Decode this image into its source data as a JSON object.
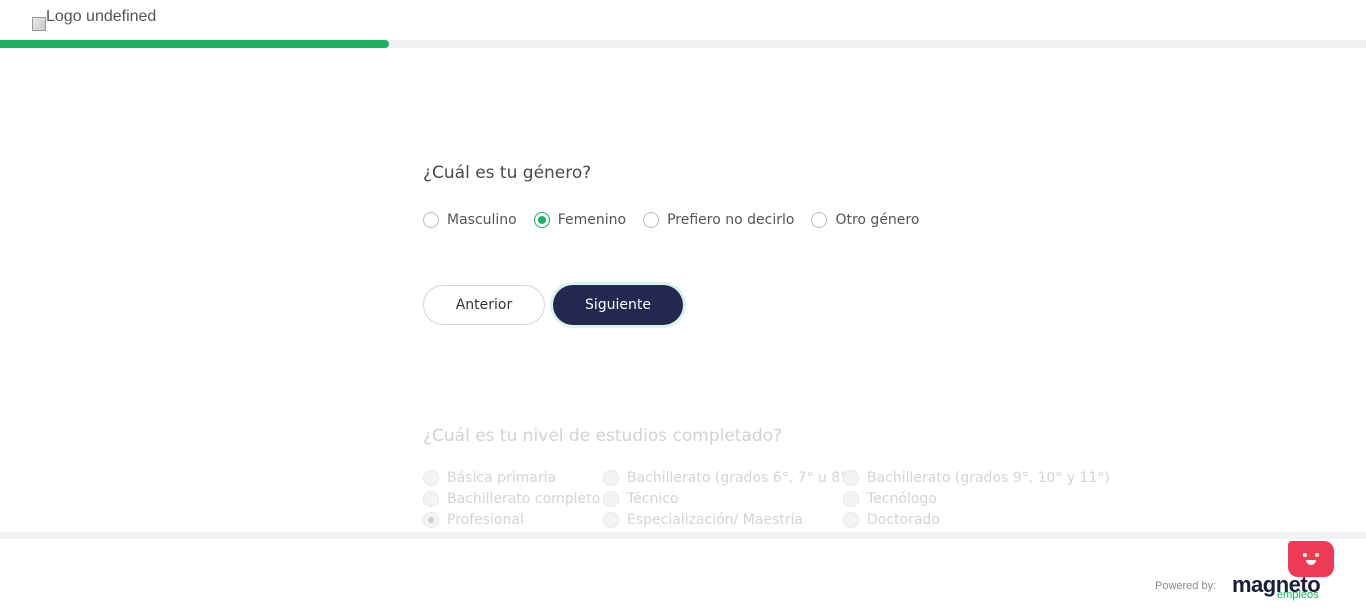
{
  "header": {
    "logo_alt": "Logo undefined",
    "progress_percent": 28.5,
    "progress_color": "#1cb15e"
  },
  "question1": {
    "title": "¿Cuál es tu género?",
    "options": [
      {
        "label": "Masculino",
        "checked": false
      },
      {
        "label": "Femenino",
        "checked": true
      },
      {
        "label": "Prefiero no decirlo",
        "checked": false
      },
      {
        "label": "Otro género",
        "checked": false
      }
    ]
  },
  "buttons": {
    "prev_label": "Anterior",
    "next_label": "Siguiente"
  },
  "question2": {
    "title": "¿Cuál es tu nivel de estudios completado?",
    "options": [
      {
        "label": "Básica primaria",
        "checked": false
      },
      {
        "label": "Bachillerato (grados 6°, 7° u 8°)",
        "checked": false
      },
      {
        "label": "Bachillerato (grados 9°, 10° y 11°)",
        "checked": false
      },
      {
        "label": "Bachillerato completo",
        "checked": false
      },
      {
        "label": "Técnico",
        "checked": false
      },
      {
        "label": "Tecnólogo",
        "checked": false
      },
      {
        "label": "Profesional",
        "checked": true
      },
      {
        "label": "Especialización/ Maestría",
        "checked": false
      },
      {
        "label": "Doctorado",
        "checked": false
      }
    ]
  },
  "footer": {
    "powered_by": "Powered by:",
    "brand_name": "magneto",
    "brand_sub": "empleos",
    "chat_icon": "chatbot-face-icon",
    "colors": {
      "accent": "#1cb15e",
      "primary": "#232850",
      "chat": "#ee3b55"
    }
  }
}
